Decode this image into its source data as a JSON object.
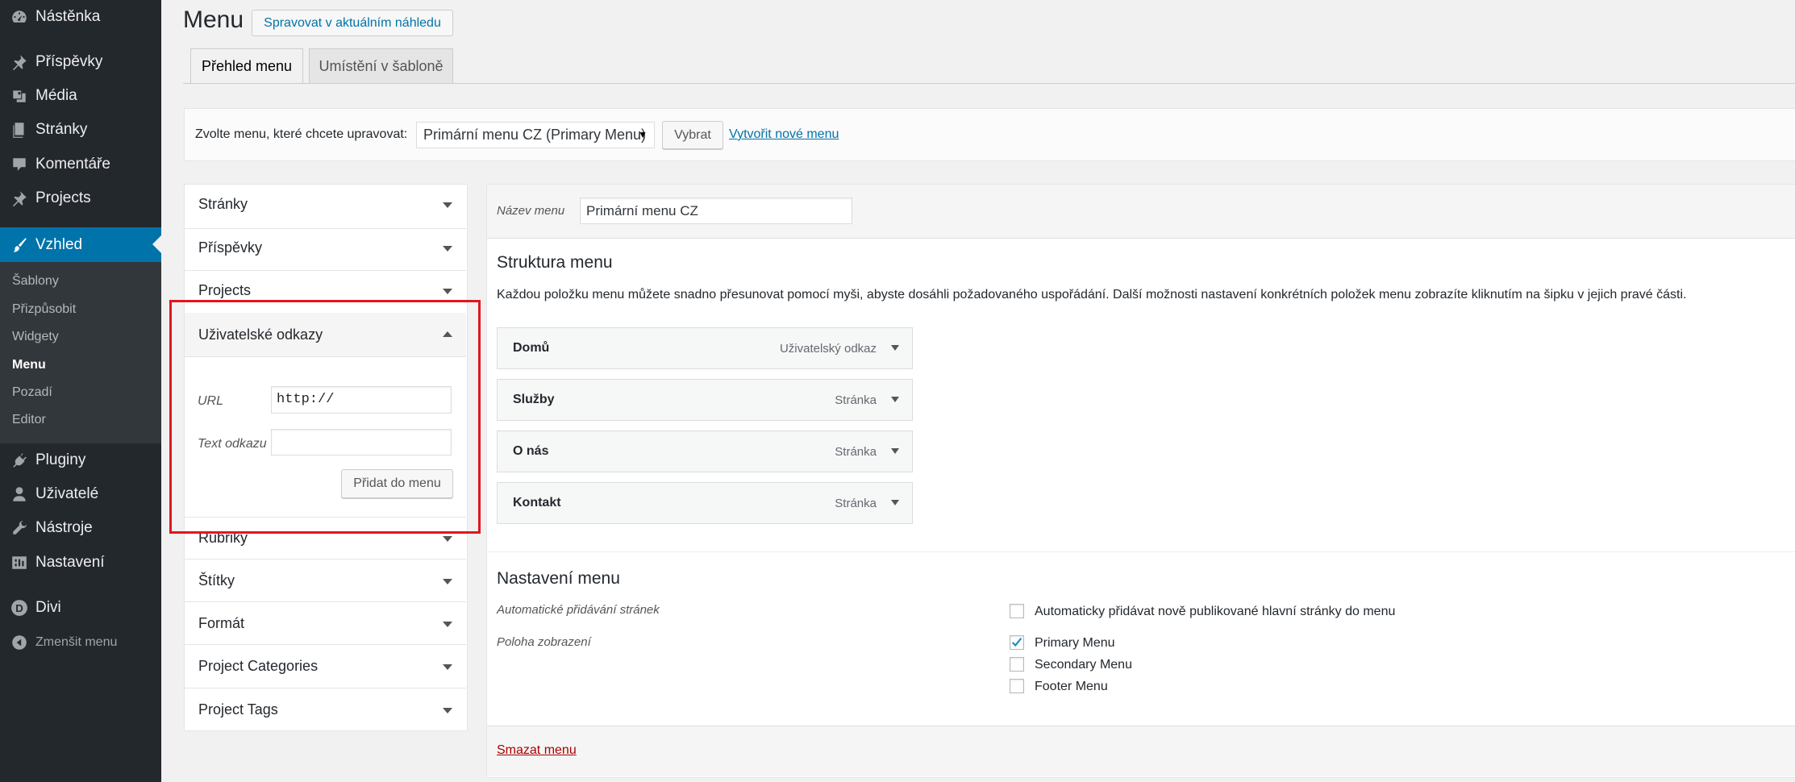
{
  "sidebar": {
    "items": [
      {
        "label": "Nástěnka",
        "icon": "dashboard-icon"
      },
      {
        "label": "Příspěvky",
        "icon": "pin-icon"
      },
      {
        "label": "Média",
        "icon": "media-icon"
      },
      {
        "label": "Stránky",
        "icon": "page-icon"
      },
      {
        "label": "Komentáře",
        "icon": "comment-icon"
      },
      {
        "label": "Projects",
        "icon": "pin-icon"
      },
      {
        "label": "Vzhled",
        "icon": "brush-icon"
      },
      {
        "label": "Pluginy",
        "icon": "plugin-icon"
      },
      {
        "label": "Uživatelé",
        "icon": "user-icon"
      },
      {
        "label": "Nástroje",
        "icon": "wrench-icon"
      },
      {
        "label": "Nastavení",
        "icon": "settings-icon"
      },
      {
        "label": "Divi",
        "icon": "divi-icon"
      }
    ],
    "submenu": [
      "Šablony",
      "Přizpůsobit",
      "Widgety",
      "Menu",
      "Pozadí",
      "Editor"
    ],
    "collapse_label": "Zmenšit menu",
    "accent": "#0073aa",
    "bg": "#23282d"
  },
  "header": {
    "title": "Menu",
    "live_preview_button": "Spravovat v aktuálním náhledu",
    "tabs": [
      "Přehled menu",
      "Umístění v šabloně"
    ]
  },
  "manage": {
    "label": "Zvolte menu, které chcete upravovat:",
    "selected_menu": "Primární menu CZ (Primary Menu)",
    "select_button": "Vybrat",
    "create_link": "Vytvořit nové menu"
  },
  "accordion": {
    "sections": [
      "Stránky",
      "Příspěvky",
      "Projects",
      "Uživatelské odkazy",
      "Rubriky",
      "Štítky",
      "Formát",
      "Project Categories",
      "Project Tags"
    ],
    "custom_links": {
      "url_label": "URL",
      "url_value": "http://",
      "text_label": "Text odkazu",
      "text_value": "",
      "add_button": "Přidat do menu"
    }
  },
  "editor": {
    "name_label": "Název menu",
    "name_value": "Primární menu CZ",
    "structure_title": "Struktura menu",
    "structure_desc": "Každou položku menu můžete snadno přesunovat pomocí myši, abyste dosáhli požadovaného uspořádání. Další možnosti nastavení konkrétních položek menu zobrazíte kliknutím na šipku v jejich pravé části.",
    "items": [
      {
        "title": "Domů",
        "type": "Uživatelský odkaz"
      },
      {
        "title": "Služby",
        "type": "Stránka"
      },
      {
        "title": "O nás",
        "type": "Stránka"
      },
      {
        "title": "Kontakt",
        "type": "Stránka"
      }
    ],
    "settings_title": "Nastavení menu",
    "auto_add_label": "Automatické přidávání stránek",
    "auto_add_option": "Automaticky přidávat nově publikované hlavní stránky do menu",
    "auto_add_checked": false,
    "location_label": "Poloha zobrazení",
    "locations": [
      {
        "label": "Primary Menu",
        "checked": true
      },
      {
        "label": "Secondary Menu",
        "checked": false
      },
      {
        "label": "Footer Menu",
        "checked": false
      }
    ],
    "delete_link": "Smazat menu"
  }
}
